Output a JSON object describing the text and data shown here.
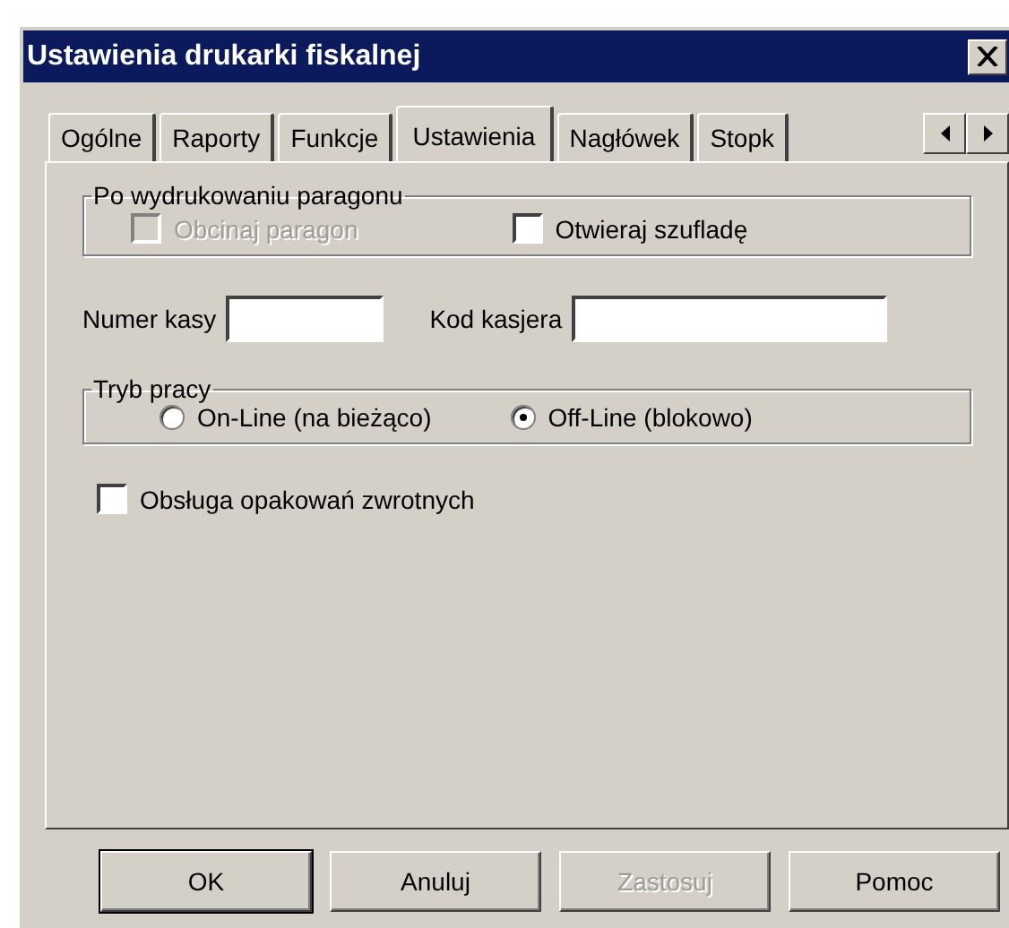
{
  "window": {
    "title": "Ustawienia drukarki fiskalnej"
  },
  "tabs": [
    {
      "label": "Ogólne",
      "selected": false
    },
    {
      "label": "Raporty",
      "selected": false
    },
    {
      "label": "Funkcje",
      "selected": false
    },
    {
      "label": "Ustawienia",
      "selected": true
    },
    {
      "label": "Nagłówek",
      "selected": false
    },
    {
      "label": "Stopk",
      "selected": false
    }
  ],
  "receipt_group": {
    "title": "Po wydrukowaniu paragonu",
    "options": [
      {
        "label": "Obcinaj paragon",
        "checked": false,
        "disabled": true
      },
      {
        "label": "Otwieraj szufladę",
        "checked": false,
        "disabled": false
      }
    ]
  },
  "fields": [
    {
      "label": "Numer kasy"
    },
    {
      "label": "Kod kasjera"
    }
  ],
  "mode_group": {
    "title": "Tryb pracy",
    "options": [
      {
        "label": "On-Line (na bieżąco)",
        "selected": false
      },
      {
        "label": "Off-Line (blokowo)",
        "selected": true
      }
    ]
  },
  "returnable": {
    "label": "Obsługa opakowań zwrotnych",
    "checked": false
  },
  "buttons": [
    {
      "label": "OK",
      "disabled": false,
      "default": true
    },
    {
      "label": "Anuluj",
      "disabled": false,
      "default": false
    },
    {
      "label": "Zastosuj",
      "disabled": true,
      "default": false
    },
    {
      "label": "Pomoc",
      "disabled": false,
      "default": false
    }
  ]
}
